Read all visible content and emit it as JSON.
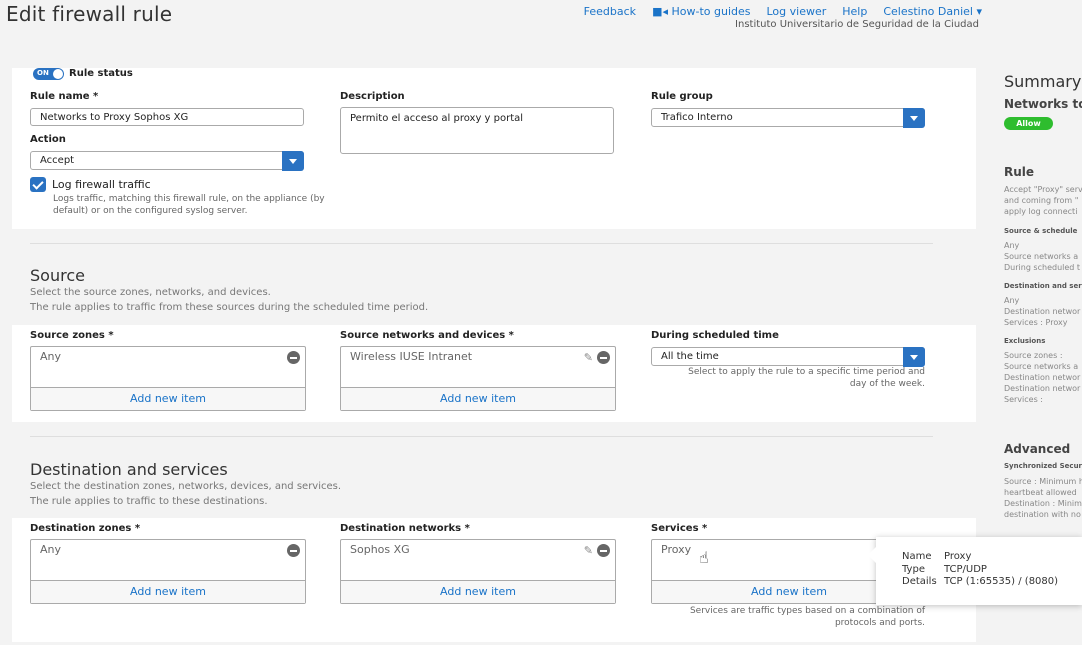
{
  "header": {
    "title": "Edit firewall rule",
    "nav": [
      "Feedback",
      "How-to guides",
      "Log viewer",
      "Help",
      "Celestino Daniel"
    ],
    "org": "Instituto Universitario de Seguridad de la Ciudad"
  },
  "rule": {
    "toggle_label": "ON",
    "status_label": "Rule status",
    "name_label": "Rule name *",
    "name_value": "Networks to Proxy Sophos XG",
    "description_label": "Description",
    "description_value": "Permito el  acceso al proxy y portal",
    "group_label": "Rule group",
    "group_value": "Trafico Interno",
    "action_label": "Action",
    "action_value": "Accept",
    "log_label": "Log firewall traffic",
    "log_hint": "Logs traffic, matching this firewall rule, on the appliance (by default) or on the configured syslog server."
  },
  "source": {
    "title": "Source",
    "desc1": "Select the source zones, networks, and devices.",
    "desc2": "The rule applies to traffic from these sources during the scheduled time period.",
    "zones_label": "Source zones *",
    "zones_item": "Any",
    "networks_label": "Source networks and devices *",
    "networks_item": "Wireless IUSE Intranet",
    "schedule_label": "During scheduled time",
    "schedule_value": "All the time",
    "schedule_hint": "Select to apply the rule to a specific time period and day of the week.",
    "add_label": "Add new item"
  },
  "destination": {
    "title": "Destination and services",
    "desc1": "Select the destination zones, networks, devices, and services.",
    "desc2": "The rule applies to traffic to these destinations.",
    "zones_label": "Destination zones *",
    "zones_item": "Any",
    "networks_label": "Destination networks *",
    "networks_item": "Sophos XG",
    "services_label": "Services *",
    "services_item": "Proxy",
    "services_hint": "Services are traffic types based on a combination of protocols and ports.",
    "add_label": "Add new item"
  },
  "tooltip": {
    "name_key": "Name",
    "name_val": "Proxy",
    "type_key": "Type",
    "type_val": "TCP/UDP",
    "details_key": "Details",
    "details_val": "TCP (1:65535) / (8080)"
  },
  "summary": {
    "title": "Summary",
    "subtitle": "Networks to",
    "badge": "Allow",
    "rule_heading": "Rule",
    "rule_text1": "Accept \"Proxy\" serv",
    "rule_text2": "and coming from \"",
    "rule_text3": "apply log connecti",
    "src_heading": "Source & schedule",
    "src_1": "Any",
    "src_2": "Source networks a",
    "src_3": "During scheduled t",
    "dst_heading": "Destination and servic",
    "dst_1": "Any",
    "dst_2": "Destination networ",
    "dst_3": "Services : Proxy",
    "exc_heading": "Exclusions",
    "exc_1": "Source zones :",
    "exc_2": "Source networks a",
    "exc_3": "Destination networ",
    "exc_4": "Destination networ",
    "exc_5": "Services :",
    "adv_heading": "Advanced",
    "adv_sub": "Synchronized Securit",
    "adv_1": "Source : Minimum h",
    "adv_2": "heartbeat allowed",
    "adv_3": "Destination : Minim",
    "adv_4": "destination with no"
  },
  "colors": {
    "accent": "#2a72c2",
    "link": "#1a73c8",
    "allow": "#2ebd2e"
  },
  "icons": [
    "video-icon",
    "chevron-down-icon",
    "minus-circle-icon",
    "pencil-icon",
    "checkbox-icon",
    "hand-cursor-icon"
  ]
}
